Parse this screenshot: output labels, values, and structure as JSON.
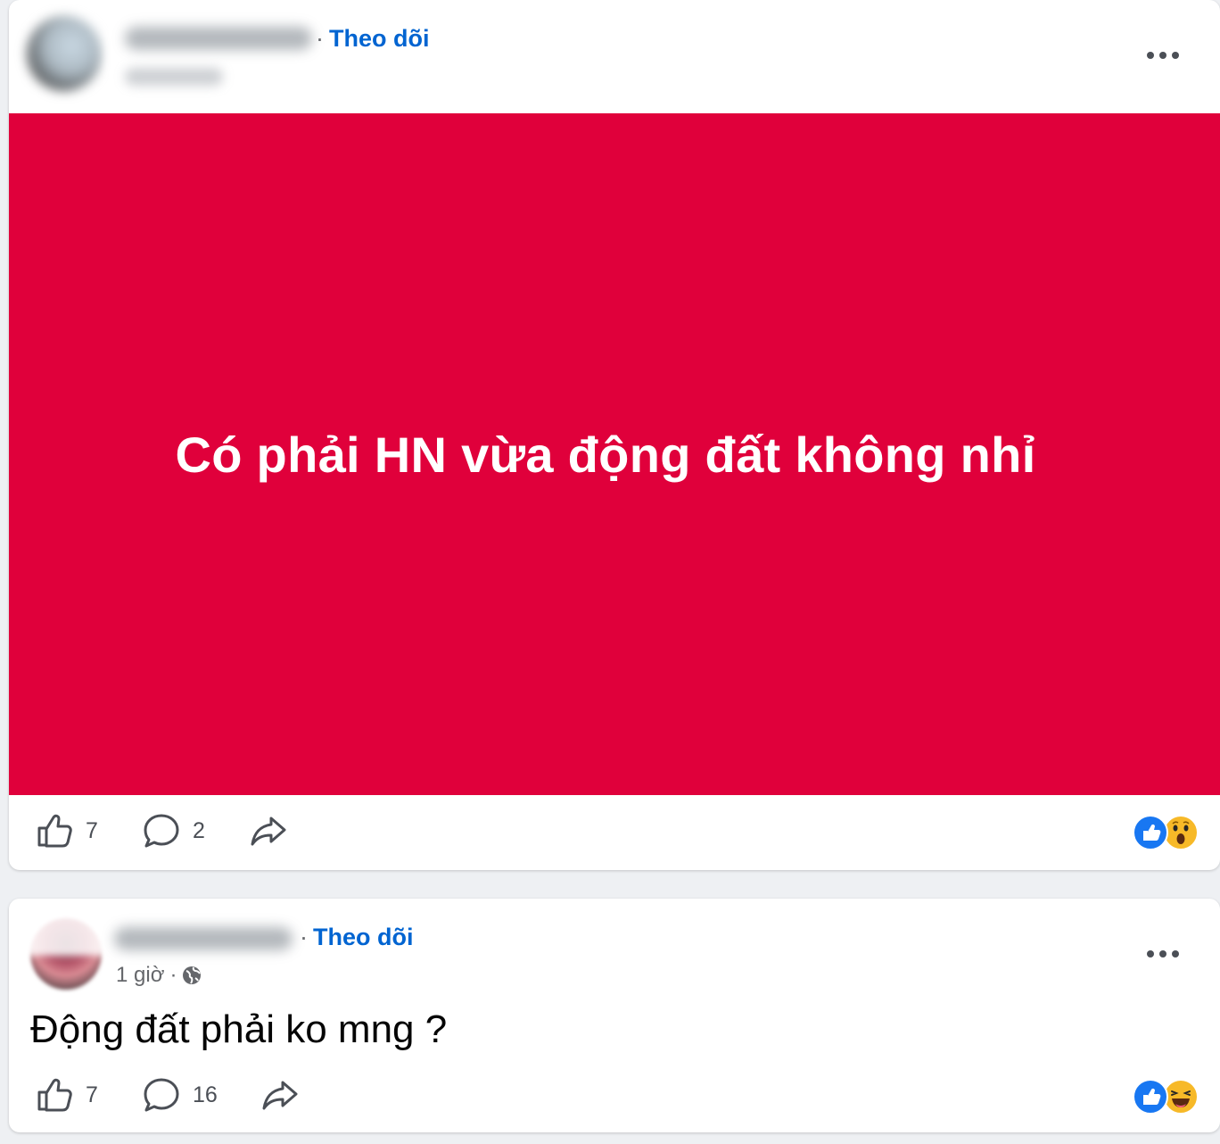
{
  "posts": [
    {
      "follow_label": "Theo dõi",
      "banner_text": "Có phải HN vừa động đất không nhỉ",
      "banner_color": "#e0003b",
      "likes": "7",
      "comments": "2",
      "reactions": [
        "like-icon",
        "wow-icon"
      ]
    },
    {
      "follow_label": "Theo dõi",
      "time": "1 giờ",
      "text": "Động đất phải ko mng ?",
      "likes": "7",
      "comments": "16",
      "reactions": [
        "like-icon",
        "haha-icon"
      ]
    }
  ],
  "colors": {
    "accent": "#0064d1",
    "like_blue": "#1877f2",
    "emoji_yellow": "#f7b928"
  }
}
